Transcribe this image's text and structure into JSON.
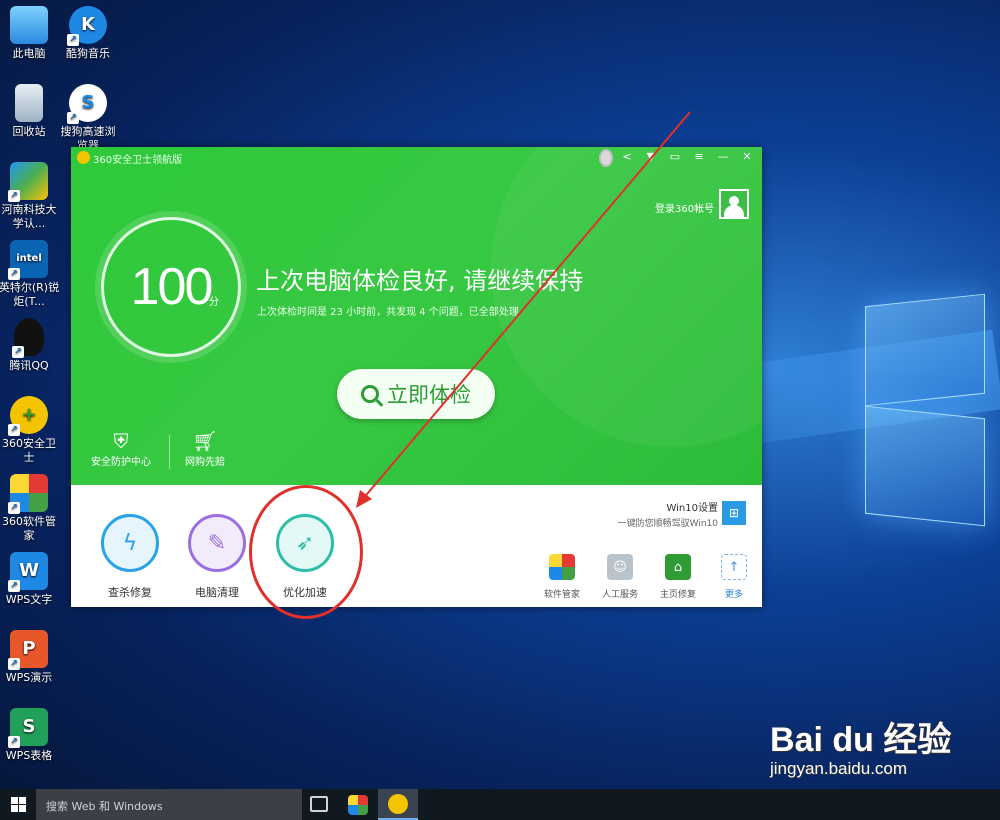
{
  "desktop": {
    "icons": [
      {
        "label": "此电脑",
        "icon": "computer-icon"
      },
      {
        "label": "酷狗音乐",
        "icon": "kugou-icon"
      },
      {
        "label": "回收站",
        "icon": "recycle-bin-icon"
      },
      {
        "label": "搜狗高速浏览器",
        "icon": "sogou-browser-icon"
      },
      {
        "label": "河南科技大学认...",
        "icon": "network-auth-icon"
      },
      {
        "label": "英特尔(R)锐炬(T...",
        "icon": "intel-graphics-icon"
      },
      {
        "label": "腾讯QQ",
        "icon": "qq-icon"
      },
      {
        "label": "360安全卫士",
        "icon": "360-security-icon"
      },
      {
        "label": "360软件管家",
        "icon": "360-software-icon"
      },
      {
        "label": "WPS文字",
        "icon": "wps-writer-icon"
      },
      {
        "label": "WPS演示",
        "icon": "wps-presentation-icon"
      },
      {
        "label": "WPS表格",
        "icon": "wps-spreadsheet-icon"
      }
    ]
  },
  "app": {
    "title": "360安全卫士领航版",
    "login_text": "登录360帐号",
    "score": "100",
    "score_unit": "分",
    "headline": "上次电脑体检良好, 请继续保持",
    "subline": "上次体检时间是 23 小时前，共发现 4 个问题，已全部处理",
    "check_button": "立即体检",
    "left_tools": [
      {
        "label": "安全防护中心",
        "icon": "shield-icon"
      },
      {
        "label": "网购先赔",
        "icon": "shopping-cart-icon"
      }
    ],
    "main_tools": [
      {
        "label": "查杀修复",
        "icon": "lightning-icon",
        "color": "#2aa3e6"
      },
      {
        "label": "电脑清理",
        "icon": "broom-icon",
        "color": "#9b6fe0"
      },
      {
        "label": "优化加速",
        "icon": "rocket-icon",
        "color": "#2bbfa8"
      }
    ],
    "win10": {
      "title": "Win10设置",
      "subtitle": "一键防您顺畅驾驭Win10"
    },
    "small_tools": [
      {
        "label": "软件管家",
        "icon": "software-manager-icon"
      },
      {
        "label": "人工服务",
        "icon": "human-service-icon"
      },
      {
        "label": "主页修复",
        "icon": "home-repair-icon"
      },
      {
        "label": "更多",
        "icon": "more-icon"
      }
    ],
    "accent": "#37c842"
  },
  "taskbar": {
    "search_placeholder": "搜索 Web 和 Windows"
  },
  "watermark": {
    "logo": "Bai du 经验",
    "url": "jingyan.baidu.com"
  }
}
